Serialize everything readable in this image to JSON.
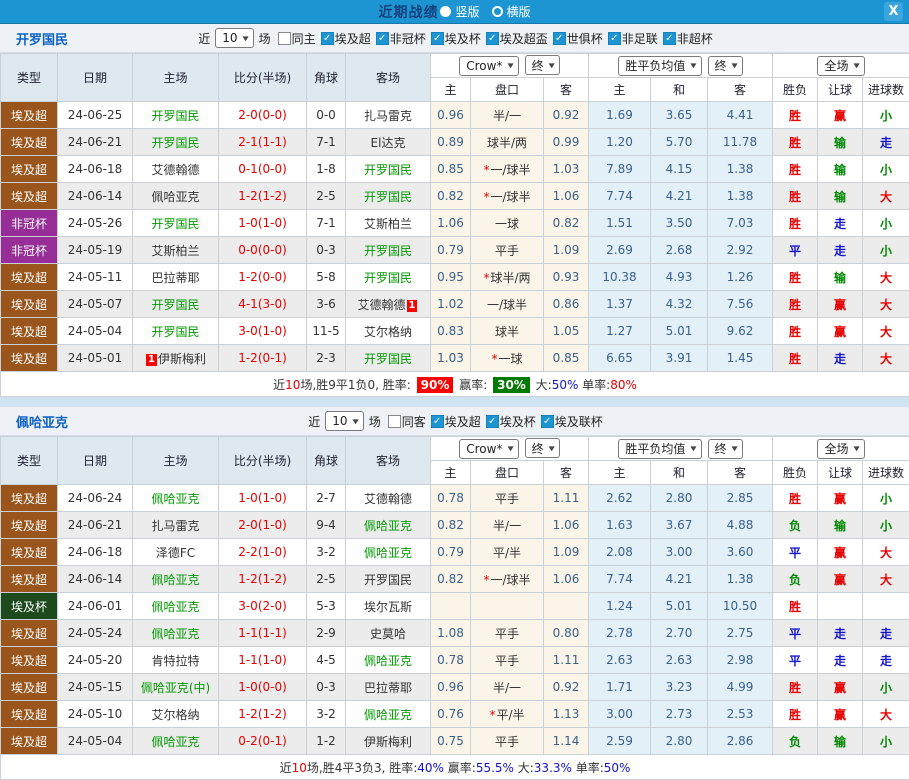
{
  "topbar": {
    "title": "近期战绩",
    "vertical_label": "竖版",
    "horizontal_label": "横版",
    "close_glyph": "X"
  },
  "table_header": {
    "main": [
      "类型",
      "日期",
      "主场",
      "比分(半场)",
      "角球",
      "客场"
    ],
    "odds_select": "Crow*",
    "final_label": "终",
    "avg_select": "胜平负均值",
    "scope_select": "全场",
    "sub": [
      "主",
      "盘口",
      "客",
      "主",
      "和",
      "客",
      "胜负",
      "让球",
      "进球数"
    ],
    "check_glyph": "✓",
    "chevron_glyph": "▼"
  },
  "colors": {
    "topbar_bg": "#1e95d3",
    "type_colors": {
      "埃及超": "#99551c",
      "非冠杯": "#972d97",
      "埃及杯": "#1d4a1d"
    },
    "focal_team": "#009900",
    "score_text": "#e60000",
    "odds_bg": "#fbf4e8",
    "avg_bg": "#e3f0f8",
    "result_colors": {
      "胜": "#e60000",
      "平": "#1414cc",
      "负": "#008800",
      "赢": "#e60000",
      "输": "#008800",
      "走": "#1414cc",
      "大": "#e60000",
      "小": "#008800"
    }
  },
  "sections": [
    {
      "team": "开罗国民",
      "filter": {
        "recent_label": "近",
        "count": "10",
        "matches_label": "场",
        "same_label": "同主",
        "same_checked": false,
        "leagues": [
          "埃及超",
          "非冠杯",
          "埃及杯",
          "埃及超盃",
          "世俱杯",
          "非足联",
          "非超杯"
        ]
      },
      "rows": [
        {
          "type": "埃及超",
          "date": "24-06-25",
          "home": "开罗国民",
          "hf": true,
          "hb": "",
          "score": "2-0",
          "half": "(0-0)",
          "corner": "0-0",
          "away": "扎马雷克",
          "af": false,
          "ab": "",
          "o1": "0.96",
          "hc": "半/一",
          "o2": "0.92",
          "w": "1.69",
          "d": "3.65",
          "l": "4.41",
          "r1": "胜",
          "r2": "赢",
          "r3": "小"
        },
        {
          "type": "埃及超",
          "date": "24-06-21",
          "home": "开罗国民",
          "hf": true,
          "hb": "",
          "score": "2-1",
          "half": "(1-1)",
          "corner": "7-1",
          "away": "El达克",
          "af": false,
          "ab": "",
          "o1": "0.89",
          "hc": "球半/两",
          "o2": "0.99",
          "w": "1.20",
          "d": "5.70",
          "l": "11.78",
          "r1": "胜",
          "r2": "输",
          "r3": "走"
        },
        {
          "type": "埃及超",
          "date": "24-06-18",
          "home": "艾德翰德",
          "hf": false,
          "hb": "",
          "score": "0-1",
          "half": "(0-0)",
          "corner": "1-8",
          "away": "开罗国民",
          "af": true,
          "ab": "",
          "o1": "0.85",
          "hc": "*一/球半",
          "o2": "1.03",
          "w": "7.89",
          "d": "4.15",
          "l": "1.38",
          "r1": "胜",
          "r2": "输",
          "r3": "小"
        },
        {
          "type": "埃及超",
          "date": "24-06-14",
          "home": "佩哈亚克",
          "hf": false,
          "hb": "",
          "score": "1-2",
          "half": "(1-2)",
          "corner": "2-5",
          "away": "开罗国民",
          "af": true,
          "ab": "",
          "o1": "0.82",
          "hc": "*一/球半",
          "o2": "1.06",
          "w": "7.74",
          "d": "4.21",
          "l": "1.38",
          "r1": "胜",
          "r2": "输",
          "r3": "大"
        },
        {
          "type": "非冠杯",
          "date": "24-05-26",
          "home": "开罗国民",
          "hf": true,
          "hb": "",
          "score": "1-0",
          "half": "(1-0)",
          "corner": "7-1",
          "away": "艾斯柏兰",
          "af": false,
          "ab": "",
          "o1": "1.06",
          "hc": "一球",
          "o2": "0.82",
          "w": "1.51",
          "d": "3.50",
          "l": "7.03",
          "r1": "胜",
          "r2": "走",
          "r3": "小"
        },
        {
          "type": "非冠杯",
          "date": "24-05-19",
          "home": "艾斯柏兰",
          "hf": false,
          "hb": "",
          "score": "0-0",
          "half": "(0-0)",
          "corner": "0-3",
          "away": "开罗国民",
          "af": true,
          "ab": "",
          "o1": "0.79",
          "hc": "平手",
          "o2": "1.09",
          "w": "2.69",
          "d": "2.68",
          "l": "2.92",
          "r1": "平",
          "r2": "走",
          "r3": "小"
        },
        {
          "type": "埃及超",
          "date": "24-05-11",
          "home": "巴拉蒂耶",
          "hf": false,
          "hb": "",
          "score": "1-2",
          "half": "(0-0)",
          "corner": "5-8",
          "away": "开罗国民",
          "af": true,
          "ab": "",
          "o1": "0.95",
          "hc": "*球半/两",
          "o2": "0.93",
          "w": "10.38",
          "d": "4.93",
          "l": "1.26",
          "r1": "胜",
          "r2": "输",
          "r3": "大"
        },
        {
          "type": "埃及超",
          "date": "24-05-07",
          "home": "开罗国民",
          "hf": true,
          "hb": "",
          "score": "4-1",
          "half": "(3-0)",
          "corner": "3-6",
          "away": "艾德翰德",
          "af": false,
          "ab": "1",
          "o1": "1.02",
          "hc": "一/球半",
          "o2": "0.86",
          "w": "1.37",
          "d": "4.32",
          "l": "7.56",
          "r1": "胜",
          "r2": "赢",
          "r3": "大"
        },
        {
          "type": "埃及超",
          "date": "24-05-04",
          "home": "开罗国民",
          "hf": true,
          "hb": "",
          "score": "3-0",
          "half": "(1-0)",
          "corner": "11-5",
          "away": "艾尔格纳",
          "af": false,
          "ab": "",
          "o1": "0.83",
          "hc": "球半",
          "o2": "1.05",
          "w": "1.27",
          "d": "5.01",
          "l": "9.62",
          "r1": "胜",
          "r2": "赢",
          "r3": "大"
        },
        {
          "type": "埃及超",
          "date": "24-05-01",
          "home": "伊斯梅利",
          "hf": false,
          "hb": "1",
          "score": "1-2",
          "half": "(0-1)",
          "corner": "2-3",
          "away": "开罗国民",
          "af": true,
          "ab": "",
          "o1": "1.03",
          "hc": "*一球",
          "o2": "0.85",
          "w": "6.65",
          "d": "3.91",
          "l": "1.45",
          "r1": "胜",
          "r2": "走",
          "r3": "大"
        }
      ],
      "summary": [
        {
          "t": "近",
          "s": "plain"
        },
        {
          "t": "10",
          "s": "red"
        },
        {
          "t": "场,胜9平1负0, 胜率: ",
          "s": "plain"
        },
        {
          "t": "90%",
          "s": "badge-red"
        },
        {
          "t": " 赢率: ",
          "s": "plain"
        },
        {
          "t": "30%",
          "s": "badge-green"
        },
        {
          "t": " 大:",
          "s": "plain"
        },
        {
          "t": "50%",
          "s": "blue"
        },
        {
          "t": " 单率:",
          "s": "plain"
        },
        {
          "t": "80%",
          "s": "red"
        }
      ]
    },
    {
      "team": "佩哈亚克",
      "filter": {
        "recent_label": "近",
        "count": "10",
        "matches_label": "场",
        "same_label": "同客",
        "same_checked": false,
        "leagues": [
          "埃及超",
          "埃及杯",
          "埃及联杯"
        ]
      },
      "rows": [
        {
          "type": "埃及超",
          "date": "24-06-24",
          "home": "佩哈亚克",
          "hf": true,
          "hb": "",
          "score": "1-0",
          "half": "(1-0)",
          "corner": "2-7",
          "away": "艾德翰德",
          "af": false,
          "ab": "",
          "o1": "0.78",
          "hc": "平手",
          "o2": "1.11",
          "w": "2.62",
          "d": "2.80",
          "l": "2.85",
          "r1": "胜",
          "r2": "赢",
          "r3": "小"
        },
        {
          "type": "埃及超",
          "date": "24-06-21",
          "home": "扎马雷克",
          "hf": false,
          "hb": "",
          "score": "2-0",
          "half": "(1-0)",
          "corner": "9-4",
          "away": "佩哈亚克",
          "af": true,
          "ab": "",
          "o1": "0.82",
          "hc": "半/一",
          "o2": "1.06",
          "w": "1.63",
          "d": "3.67",
          "l": "4.88",
          "r1": "负",
          "r2": "输",
          "r3": "小"
        },
        {
          "type": "埃及超",
          "date": "24-06-18",
          "home": "泽德FC",
          "hf": false,
          "hb": "",
          "score": "2-2",
          "half": "(1-0)",
          "corner": "3-2",
          "away": "佩哈亚克",
          "af": true,
          "ab": "",
          "o1": "0.79",
          "hc": "平/半",
          "o2": "1.09",
          "w": "2.08",
          "d": "3.00",
          "l": "3.60",
          "r1": "平",
          "r2": "赢",
          "r3": "大"
        },
        {
          "type": "埃及超",
          "date": "24-06-14",
          "home": "佩哈亚克",
          "hf": true,
          "hb": "",
          "score": "1-2",
          "half": "(1-2)",
          "corner": "2-5",
          "away": "开罗国民",
          "af": false,
          "ab": "",
          "o1": "0.82",
          "hc": "*一/球半",
          "o2": "1.06",
          "w": "7.74",
          "d": "4.21",
          "l": "1.38",
          "r1": "负",
          "r2": "赢",
          "r3": "大"
        },
        {
          "type": "埃及杯",
          "date": "24-06-01",
          "home": "佩哈亚克",
          "hf": true,
          "hb": "",
          "score": "3-0",
          "half": "(2-0)",
          "corner": "5-3",
          "away": "埃尔瓦斯",
          "af": false,
          "ab": "",
          "o1": "",
          "hc": "",
          "o2": "",
          "w": "1.24",
          "d": "5.01",
          "l": "10.50",
          "r1": "胜",
          "r2": "",
          "r3": ""
        },
        {
          "type": "埃及超",
          "date": "24-05-24",
          "home": "佩哈亚克",
          "hf": true,
          "hb": "",
          "score": "1-1",
          "half": "(1-1)",
          "corner": "2-9",
          "away": "史莫哈",
          "af": false,
          "ab": "",
          "o1": "1.08",
          "hc": "平手",
          "o2": "0.80",
          "w": "2.78",
          "d": "2.70",
          "l": "2.75",
          "r1": "平",
          "r2": "走",
          "r3": "走"
        },
        {
          "type": "埃及超",
          "date": "24-05-20",
          "home": "肯特拉特",
          "hf": false,
          "hb": "",
          "score": "1-1",
          "half": "(1-0)",
          "corner": "4-5",
          "away": "佩哈亚克",
          "af": true,
          "ab": "",
          "o1": "0.78",
          "hc": "平手",
          "o2": "1.11",
          "w": "2.63",
          "d": "2.63",
          "l": "2.98",
          "r1": "平",
          "r2": "走",
          "r3": "走"
        },
        {
          "type": "埃及超",
          "date": "24-05-15",
          "home": "佩哈亚克(中)",
          "hf": true,
          "hb": "",
          "score": "1-0",
          "half": "(0-0)",
          "corner": "0-3",
          "away": "巴拉蒂耶",
          "af": false,
          "ab": "",
          "o1": "0.96",
          "hc": "半/一",
          "o2": "0.92",
          "w": "1.71",
          "d": "3.23",
          "l": "4.99",
          "r1": "胜",
          "r2": "赢",
          "r3": "小"
        },
        {
          "type": "埃及超",
          "date": "24-05-10",
          "home": "艾尔格纳",
          "hf": false,
          "hb": "",
          "score": "1-2",
          "half": "(1-2)",
          "corner": "3-2",
          "away": "佩哈亚克",
          "af": true,
          "ab": "",
          "o1": "0.76",
          "hc": "*平/半",
          "o2": "1.13",
          "w": "3.00",
          "d": "2.73",
          "l": "2.53",
          "r1": "胜",
          "r2": "赢",
          "r3": "大"
        },
        {
          "type": "埃及超",
          "date": "24-05-04",
          "home": "佩哈亚克",
          "hf": true,
          "hb": "",
          "score": "0-2",
          "half": "(0-1)",
          "corner": "1-2",
          "away": "伊斯梅利",
          "af": false,
          "ab": "",
          "o1": "0.75",
          "hc": "平手",
          "o2": "1.14",
          "w": "2.59",
          "d": "2.80",
          "l": "2.86",
          "r1": "负",
          "r2": "输",
          "r3": "小"
        }
      ],
      "summary": [
        {
          "t": "近",
          "s": "plain"
        },
        {
          "t": "10",
          "s": "red"
        },
        {
          "t": "场,胜4平3负3, 胜率:",
          "s": "plain"
        },
        {
          "t": "40%",
          "s": "blue"
        },
        {
          "t": " 赢率:",
          "s": "plain"
        },
        {
          "t": "55.5%",
          "s": "blue"
        },
        {
          "t": " 大:",
          "s": "plain"
        },
        {
          "t": "33.3%",
          "s": "blue"
        },
        {
          "t": " 单率:",
          "s": "plain"
        },
        {
          "t": "50%",
          "s": "blue"
        }
      ]
    }
  ]
}
